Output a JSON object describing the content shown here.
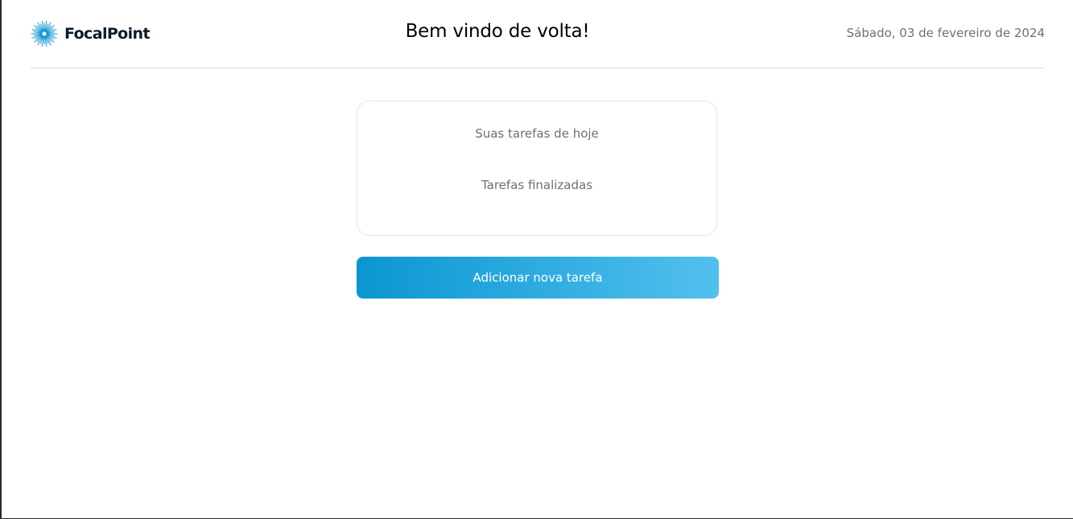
{
  "header": {
    "brand": "FocalPoint",
    "welcome": "Bem vindo de volta!",
    "date": "Sábado, 03 de fevereiro de 2024"
  },
  "tasks": {
    "today_label": "Suas tarefas de hoje",
    "done_label": "Tarefas finalizadas"
  },
  "actions": {
    "add_task_label": "Adicionar nova tarefa"
  },
  "icons": {
    "logo": "sunburst-logo-icon"
  },
  "colors": {
    "brand_accent": "#0b96d1",
    "button_gradient_start": "#0b96d1",
    "button_gradient_end": "#52c0ee",
    "text_muted": "#707070",
    "brand_text": "#0b1b2c"
  }
}
